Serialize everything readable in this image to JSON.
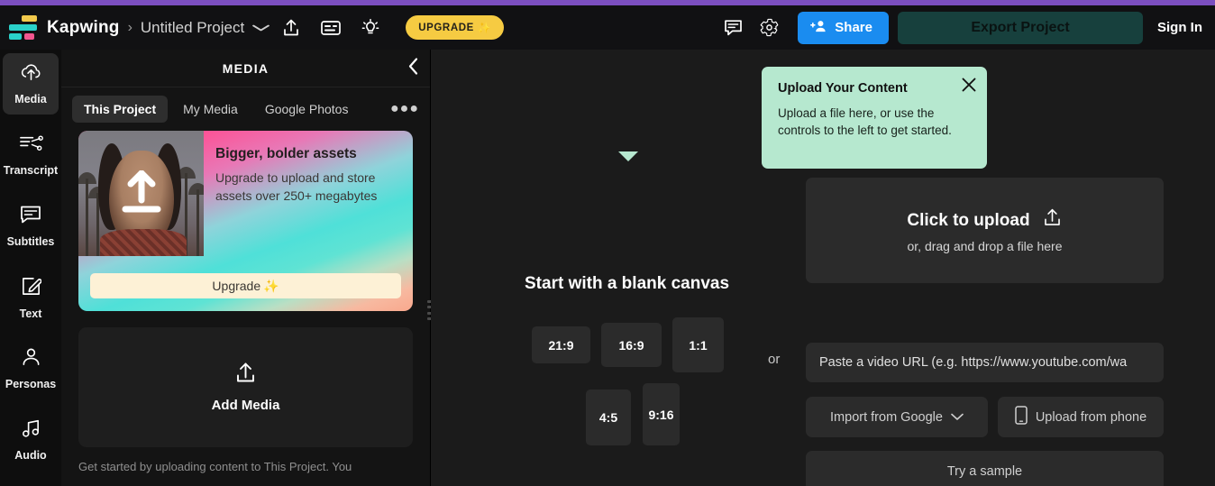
{
  "app": {
    "brand": "Kapwing",
    "project_name": "Untitled Project",
    "breadcrumb_separator": "›"
  },
  "header": {
    "project_dropdown_icon": "chevron-down-icon",
    "icons": [
      {
        "name": "share-upload-icon",
        "label": "Upload"
      },
      {
        "name": "captions-icon",
        "label": "Captions"
      },
      {
        "name": "lightbulb-icon",
        "label": "Tips"
      }
    ],
    "upgrade_label": "UPGRADE",
    "upgrade_sparkle": "✨",
    "comments_icon": "comment-icon",
    "settings_icon": "gear-icon",
    "share_label": "Share",
    "export_label": "Export Project",
    "signin_label": "Sign In",
    "accent_purple": "#7c4fc0",
    "accent_yellow": "#f6cb42",
    "accent_blue": "#1a8cf0",
    "accent_teal": "#17403d"
  },
  "rail": {
    "items": [
      {
        "label": "Media",
        "icon": "cloud-upload-icon",
        "active": true
      },
      {
        "label": "Transcript",
        "icon": "transcript-icon",
        "active": false
      },
      {
        "label": "Subtitles",
        "icon": "subtitles-icon",
        "active": false
      },
      {
        "label": "Text",
        "icon": "text-edit-icon",
        "active": false
      },
      {
        "label": "Personas",
        "icon": "person-icon",
        "active": false
      },
      {
        "label": "Audio",
        "icon": "music-note-icon",
        "active": false
      }
    ]
  },
  "media_panel": {
    "title": "MEDIA",
    "collapse_icon": "chevron-left-icon",
    "overflow_icon": "more-horizontal-icon",
    "tabs": [
      {
        "label": "This Project",
        "active": true
      },
      {
        "label": "My Media",
        "active": false
      },
      {
        "label": "Google Photos",
        "active": false
      }
    ],
    "promo": {
      "heading": "Bigger, bolder assets",
      "body": "Upgrade to upload and store assets over 250+ megabytes",
      "button_label": "Upgrade",
      "button_sparkle": "✨",
      "thumbnail_icon": "upload-arrow-overlay-icon"
    },
    "add_media": {
      "label": "Add Media",
      "icon": "upload-icon"
    },
    "footer_note": "Get started by uploading content to This Project. You"
  },
  "stage": {
    "tooltip": {
      "title": "Upload Your Content",
      "body": "Upload a file here, or use the controls to the left to get started.",
      "close_icon": "close-icon",
      "background": "#b6e8cf"
    },
    "blank_canvas": {
      "title": "Start with a blank canvas",
      "ratios": [
        "21:9",
        "16:9",
        "1:1",
        "4:5",
        "9:16"
      ]
    },
    "or_label": "or",
    "upload_box": {
      "main_label": "Click to upload",
      "icon": "upload-icon",
      "sub_label": "or, drag and drop a file here"
    },
    "url_input": {
      "placeholder": "Paste a video URL (e.g. https://www.youtube.com/wa",
      "value": ""
    },
    "buttons": [
      {
        "label": "Import from Google",
        "icon": "chevron-down-icon"
      },
      {
        "label": "Upload from phone",
        "icon": "phone-icon"
      },
      {
        "label": "Try a sample",
        "icon": ""
      }
    ]
  }
}
